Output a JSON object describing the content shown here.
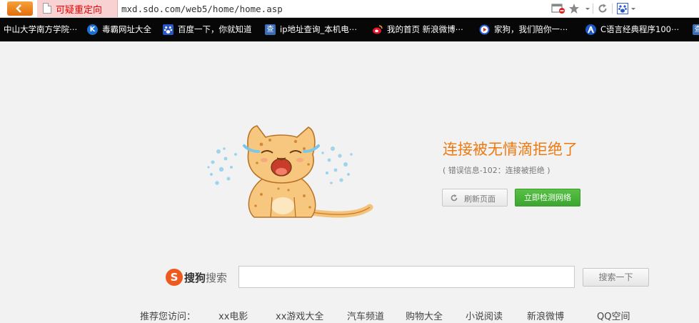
{
  "browser": {
    "redirect_label": "可疑重定向",
    "url": "mxd.sdo.com/web5/home/home.asp"
  },
  "bookmarks": [
    {
      "label": "中山大学南方学院⋯",
      "icon": "sysu-icon",
      "color": "#1f4e9a"
    },
    {
      "label": "毒霸网址大全",
      "icon": "duba-k-icon",
      "color": "#1b6fd1"
    },
    {
      "label": "百度一下，你就知道",
      "icon": "baidu-paw-icon",
      "color": "#2a57c8"
    },
    {
      "label": "ip地址查询_本机电⋯",
      "icon": "cha-icon",
      "color": "#3a6db5"
    },
    {
      "label": "我的首页 新浪微博⋯",
      "icon": "weibo-icon",
      "color": "#e6162d"
    },
    {
      "label": "家狗，我们陪你一⋯",
      "icon": "play-icon",
      "color": "#2860d8"
    },
    {
      "label": "C语言经典程序100⋯",
      "icon": "person-icon",
      "color": "#1d59c4"
    },
    {
      "label": "",
      "icon": "cha-icon",
      "color": "#3a6db5"
    }
  ],
  "error": {
    "title": "连接被无情滴拒绝了",
    "info": "( 错误信息-102：连接被拒绝 )",
    "refresh_label": "刷新页面",
    "check_label": "立即检测网络"
  },
  "search": {
    "logo_char": "S",
    "brand": "搜狗",
    "brand_suffix": "搜索",
    "button_label": "搜索一下",
    "value": ""
  },
  "recommend": {
    "heading": "推荐您访问：",
    "items": [
      "xx电影",
      "xx游戏大全",
      "汽车频道",
      "购物大全",
      "小说阅读",
      "新浪微博",
      "QQ空间"
    ]
  },
  "colors": {
    "accent_orange": "#ec7a13",
    "check_green": "#3ca530",
    "redirect_red": "#e00000"
  }
}
